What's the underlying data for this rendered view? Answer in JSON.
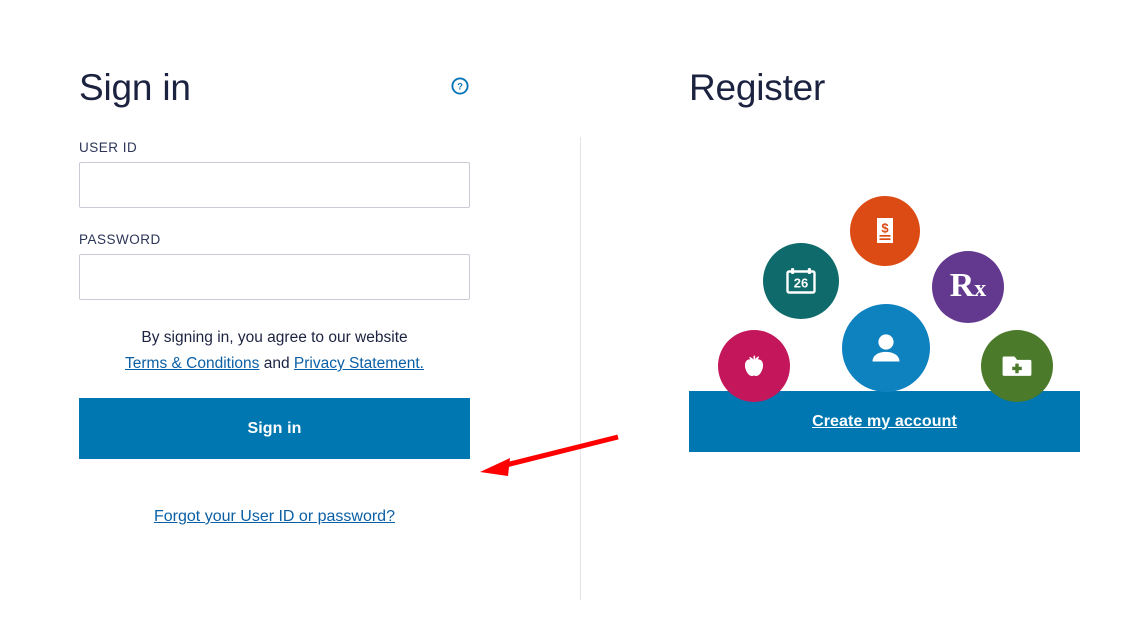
{
  "signin": {
    "title": "Sign in",
    "help_icon": "help-circle-icon",
    "user_id": {
      "label": "USER ID",
      "value": "",
      "placeholder": ""
    },
    "password": {
      "label": "PASSWORD",
      "value": "",
      "placeholder": ""
    },
    "terms": {
      "lead": "By signing in, you agree to our website",
      "terms_link": "Terms & Conditions",
      "conjunction": "and",
      "privacy_link": "Privacy Statement."
    },
    "submit_label": "Sign in",
    "forgot_label": "Forgot your User ID or password?"
  },
  "register": {
    "title": "Register",
    "create_account_label": "Create my account",
    "icons": [
      {
        "name": "bill-dollar-icon",
        "color": "#dd4b14",
        "label": "Billing"
      },
      {
        "name": "calendar-26-icon",
        "color": "#0f6b6b",
        "label": "Appointments",
        "day": "26"
      },
      {
        "name": "prescription-rx-icon",
        "color": "#63398f",
        "label": "Prescriptions",
        "text": "Rx"
      },
      {
        "name": "apple-nutrition-icon",
        "color": "#c4175b",
        "label": "Health"
      },
      {
        "name": "person-profile-icon",
        "color": "#0e81bf",
        "label": "Profile"
      },
      {
        "name": "medical-folder-icon",
        "color": "#4b7a2b",
        "label": "Records"
      }
    ]
  },
  "annotation": {
    "arrow_color": "#ff0000",
    "arrow_points_to": "Sign in"
  },
  "theme": {
    "primary": "#0077b0",
    "link": "#0b5fa5",
    "heading": "#1c2340",
    "border": "#c8cbd6",
    "divider": "#e2e4ea"
  }
}
